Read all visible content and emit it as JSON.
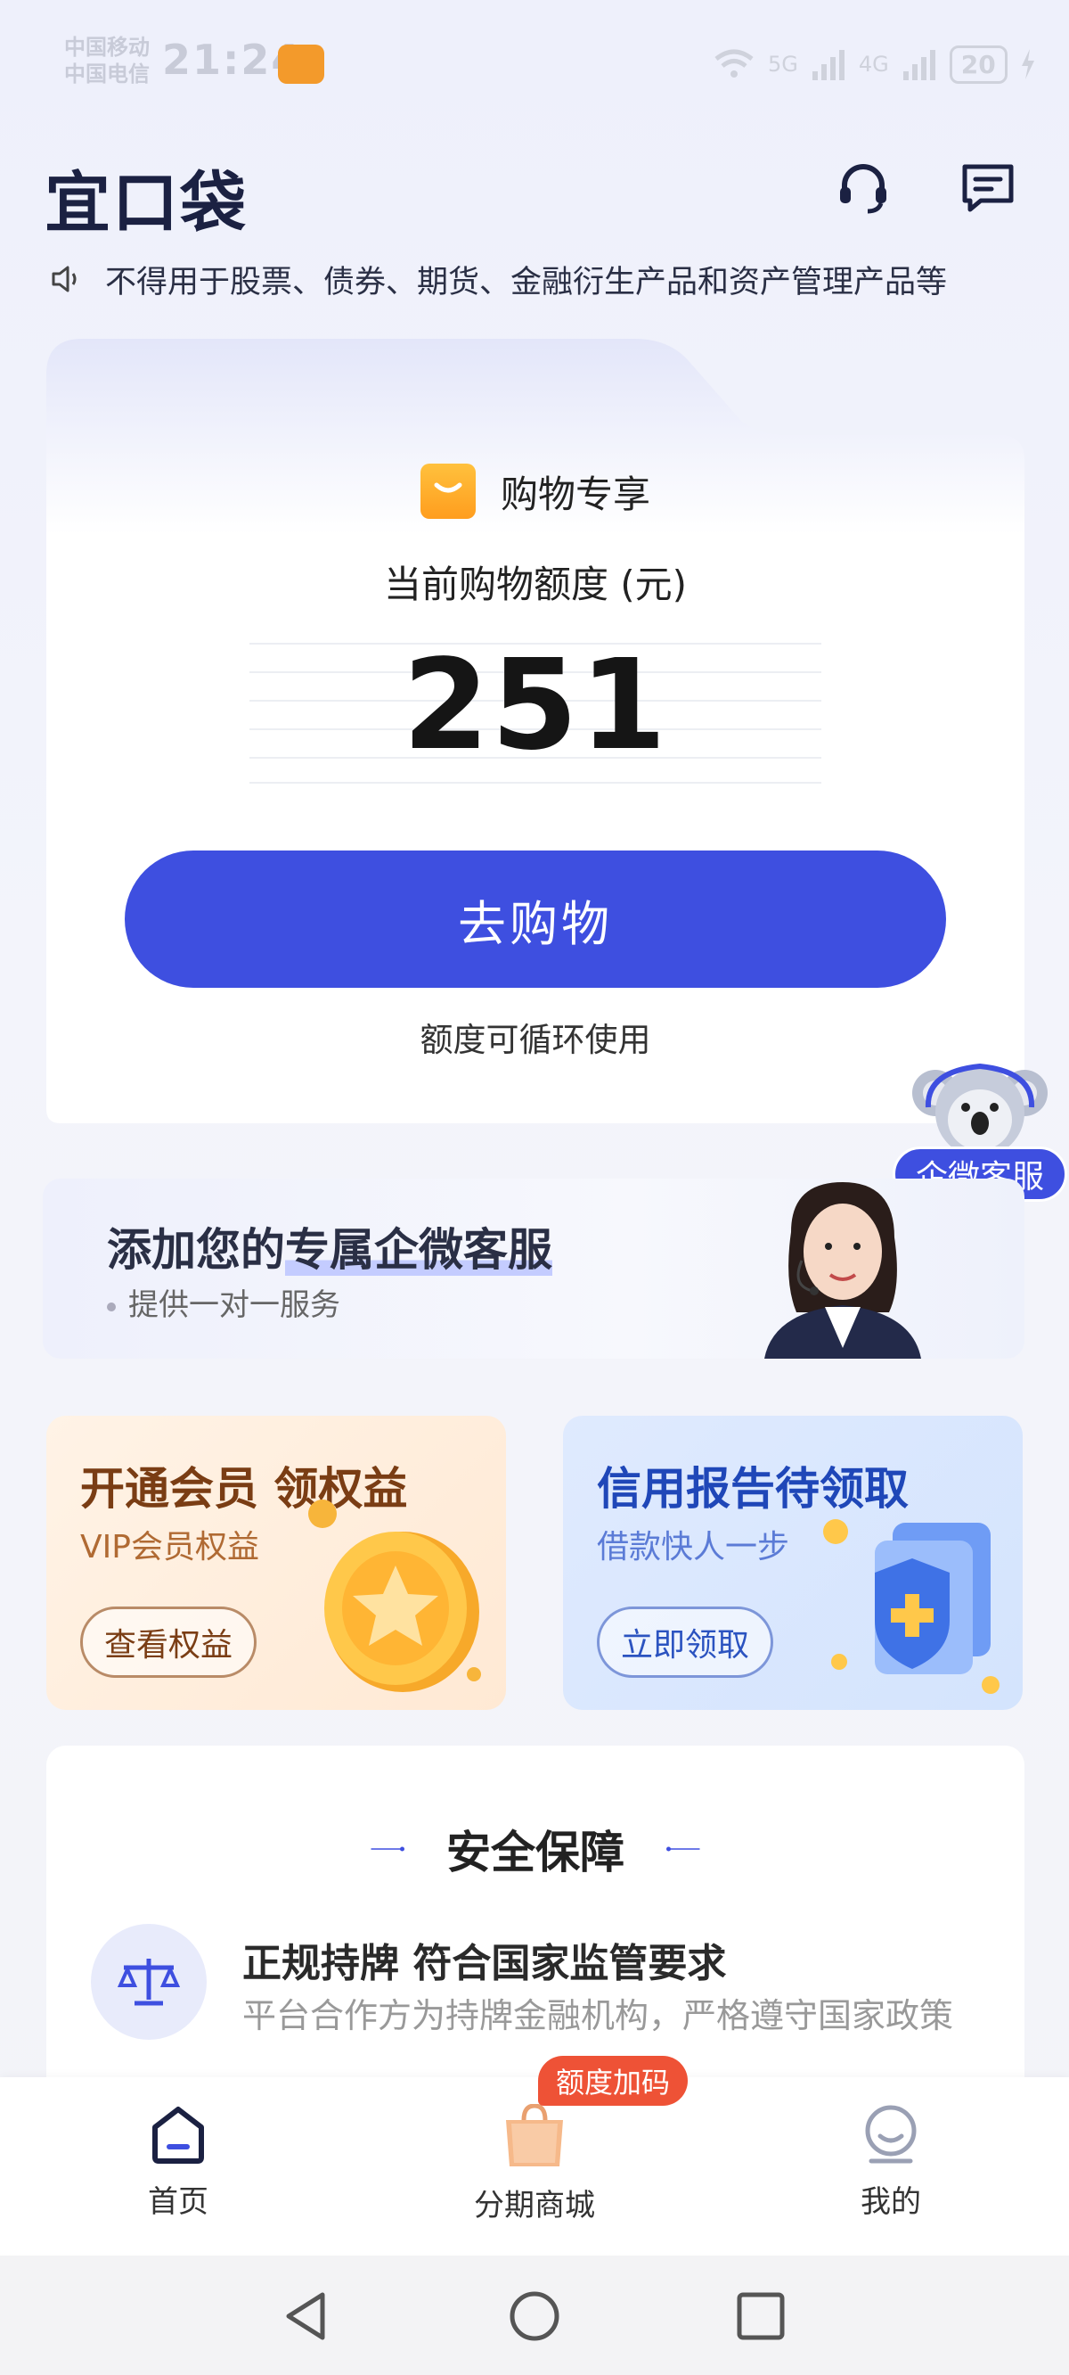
{
  "status_bar": {
    "carrier_1": "中国移动",
    "carrier_2": "中国电信",
    "time": "21:24",
    "network_1": "5G",
    "network_2": "4G",
    "battery": "20"
  },
  "header": {
    "logo": "宜口袋"
  },
  "notice": {
    "text": "不得用于股票、债券、期货、金融衍生产品和资产管理产品等"
  },
  "main_card": {
    "tag": "购物专享",
    "credit_label": "当前购物额度 (元)",
    "credit_value": "251",
    "shop_button": "去购物",
    "note": "额度可循环使用"
  },
  "floating_service": {
    "label": "企微客服"
  },
  "service_banner": {
    "title_prefix": "添加您的",
    "title_highlight": "专属企微客服",
    "subtitle": "提供一对一服务"
  },
  "promos": [
    {
      "title": "开通会员 领权益",
      "subtitle": "VIP会员权益",
      "button": "查看权益"
    },
    {
      "title": "信用报告待领取",
      "subtitle": "借款快人一步",
      "button": "立即领取"
    }
  ],
  "security": {
    "title": "安全保障",
    "item_title": "正规持牌 符合国家监管要求",
    "item_subtitle": "平台合作方为持牌金融机构，严格遵守国家政策"
  },
  "bottom_nav": {
    "items": [
      {
        "label": "首页"
      },
      {
        "label": "分期商城"
      },
      {
        "label": "我的"
      }
    ],
    "badge": "额度加码"
  },
  "colors": {
    "primary": "#3e4fe0",
    "badge": "#ee5236",
    "logo": "#1b2142"
  }
}
